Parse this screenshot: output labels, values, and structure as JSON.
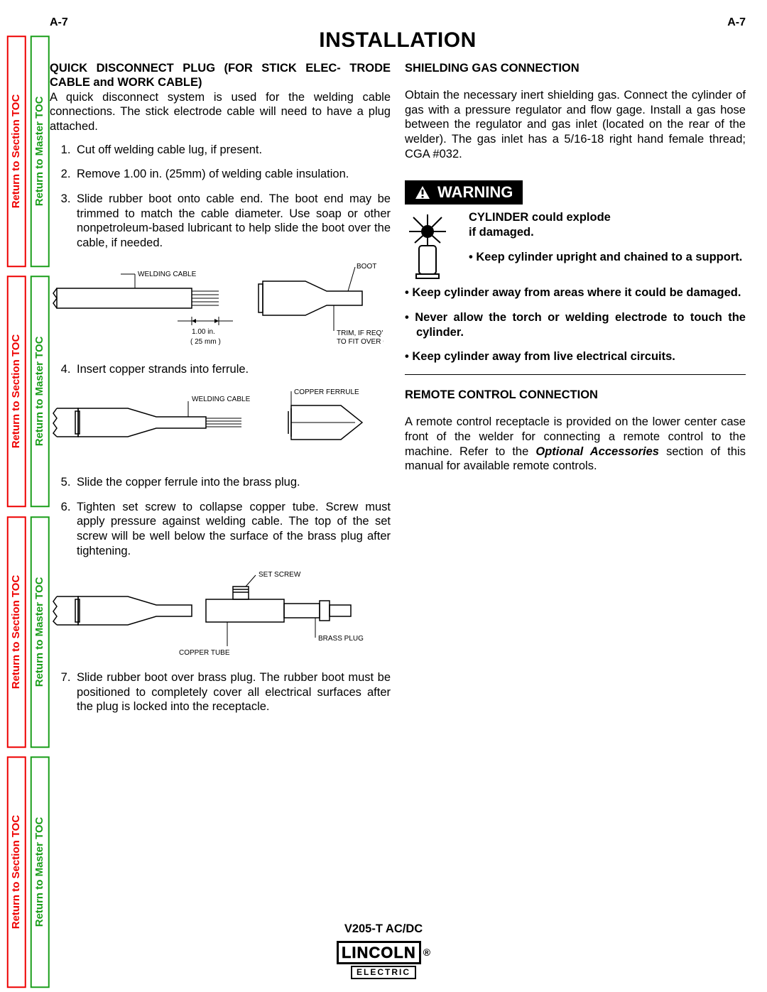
{
  "page_code": "A-7",
  "heading": "INSTALLATION",
  "sidebar": {
    "section_link": "Return to Section TOC",
    "master_link": "Return to Master TOC"
  },
  "left_column": {
    "subhead_line1": "QUICK DISCONNECT PLUG (FOR STICK ELEC-",
    "subhead_line2": "TRODE CABLE and WORK CABLE)",
    "intro": "A quick disconnect system is used for the welding cable connections. The stick electrode cable will need to have a plug attached.",
    "steps": [
      "Cut off welding cable lug, if present.",
      "Remove 1.00 in. (25mm) of welding cable insulation.",
      "Slide rubber boot onto cable end. The boot end may be trimmed to match the cable diameter. Use soap or other nonpetroleum-based lubricant to help slide the boot over the cable, if needed.",
      "Insert copper strands into ferrule.",
      "Slide the copper ferrule into the brass plug.",
      "Tighten set screw to collapse copper tube. Screw must apply pressure against welding cable. The top of the set screw will be well below the surface of the brass plug after tightening.",
      "Slide rubber boot over brass plug. The rubber boot must be positioned to completely cover all electrical surfaces after the plug is locked into the receptacle."
    ],
    "diag1": {
      "welding_cable": "WELDING CABLE",
      "boot": "BOOT",
      "dim_in": "1.00 in.",
      "dim_mm": "( 25 mm )",
      "trim1": "TRIM, IF REQ'D",
      "trim2": "TO FIT OVER CABLE"
    },
    "diag2": {
      "welding_cable": "WELDING CABLE",
      "copper_ferrule": "COPPER FERRULE"
    },
    "diag3": {
      "set_screw": "SET SCREW",
      "copper_tube": "COPPER TUBE",
      "brass_plug": "BRASS PLUG"
    }
  },
  "right_column": {
    "shielding_head": "SHIELDING GAS CONNECTION",
    "shielding_body": "Obtain the necessary inert shielding gas. Connect the cylinder of gas with a pressure regulator and flow gage. Install a gas hose between the regulator and gas inlet (located on the rear of the welder). The gas inlet has a 5/16-18 right hand female thread; CGA #032.",
    "warn_label": "WARNING",
    "warn_head1": "CYLINDER could explode",
    "warn_head2": "if damaged.",
    "warn_first_bullet": "Keep cylinder upright and chained to a support.",
    "warn_bullets": [
      "Keep cylinder away from areas where it could be damaged.",
      "Never allow the torch or welding electrode to touch the cylinder.",
      "Keep cylinder away from live electrical circuits."
    ],
    "remote_head": "REMOTE CONTROL CONNECTION",
    "remote_body_1": "A remote control receptacle is provided on the lower center case front of the welder for connecting a remote control to the machine. Refer to the ",
    "remote_body_emph": "Optional Accessories",
    "remote_body_2": " section of this manual for available remote controls."
  },
  "footer": {
    "model": "V205-T AC/DC",
    "brand_main": "LINCOLN",
    "brand_reg": "®",
    "brand_sub": "ELECTRIC"
  }
}
